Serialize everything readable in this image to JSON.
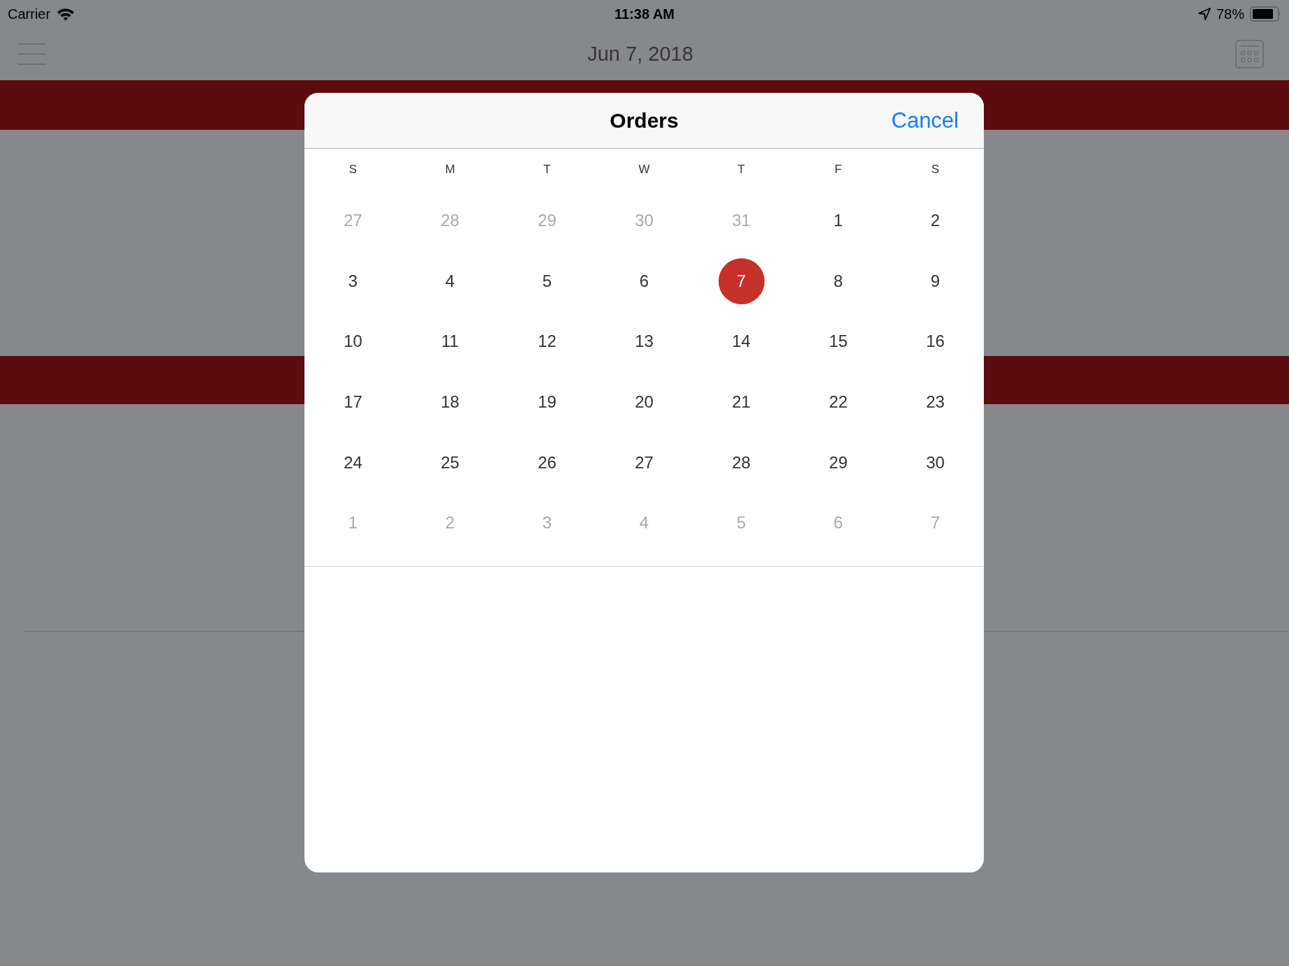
{
  "status_bar": {
    "carrier": "Carrier",
    "time": "11:38 AM",
    "battery": "78%"
  },
  "nav_bar": {
    "title": "Jun 7, 2018"
  },
  "modal": {
    "title": "Orders",
    "cancel": "Cancel",
    "weekdays": [
      "S",
      "M",
      "T",
      "W",
      "T",
      "F",
      "S"
    ],
    "weeks": [
      {
        "days": [
          {
            "day": "27",
            "in_month": false,
            "selected": false
          },
          {
            "day": "28",
            "in_month": false,
            "selected": false
          },
          {
            "day": "29",
            "in_month": false,
            "selected": false
          },
          {
            "day": "30",
            "in_month": false,
            "selected": false
          },
          {
            "day": "31",
            "in_month": false,
            "selected": false
          },
          {
            "day": "1",
            "in_month": true,
            "selected": false
          },
          {
            "day": "2",
            "in_month": true,
            "selected": false
          }
        ]
      },
      {
        "days": [
          {
            "day": "3",
            "in_month": true,
            "selected": false
          },
          {
            "day": "4",
            "in_month": true,
            "selected": false
          },
          {
            "day": "5",
            "in_month": true,
            "selected": false
          },
          {
            "day": "6",
            "in_month": true,
            "selected": false
          },
          {
            "day": "7",
            "in_month": true,
            "selected": true
          },
          {
            "day": "8",
            "in_month": true,
            "selected": false
          },
          {
            "day": "9",
            "in_month": true,
            "selected": false
          }
        ]
      },
      {
        "days": [
          {
            "day": "10",
            "in_month": true,
            "selected": false
          },
          {
            "day": "11",
            "in_month": true,
            "selected": false
          },
          {
            "day": "12",
            "in_month": true,
            "selected": false
          },
          {
            "day": "13",
            "in_month": true,
            "selected": false
          },
          {
            "day": "14",
            "in_month": true,
            "selected": false
          },
          {
            "day": "15",
            "in_month": true,
            "selected": false
          },
          {
            "day": "16",
            "in_month": true,
            "selected": false
          }
        ]
      },
      {
        "days": [
          {
            "day": "17",
            "in_month": true,
            "selected": false
          },
          {
            "day": "18",
            "in_month": true,
            "selected": false
          },
          {
            "day": "19",
            "in_month": true,
            "selected": false
          },
          {
            "day": "20",
            "in_month": true,
            "selected": false
          },
          {
            "day": "21",
            "in_month": true,
            "selected": false
          },
          {
            "day": "22",
            "in_month": true,
            "selected": false
          },
          {
            "day": "23",
            "in_month": true,
            "selected": false
          }
        ]
      },
      {
        "days": [
          {
            "day": "24",
            "in_month": true,
            "selected": false
          },
          {
            "day": "25",
            "in_month": true,
            "selected": false
          },
          {
            "day": "26",
            "in_month": true,
            "selected": false
          },
          {
            "day": "27",
            "in_month": true,
            "selected": false
          },
          {
            "day": "28",
            "in_month": true,
            "selected": false
          },
          {
            "day": "29",
            "in_month": true,
            "selected": false
          },
          {
            "day": "30",
            "in_month": true,
            "selected": false
          }
        ]
      },
      {
        "days": [
          {
            "day": "1",
            "in_month": false,
            "selected": false
          },
          {
            "day": "2",
            "in_month": false,
            "selected": false
          },
          {
            "day": "3",
            "in_month": false,
            "selected": false
          },
          {
            "day": "4",
            "in_month": false,
            "selected": false
          },
          {
            "day": "5",
            "in_month": false,
            "selected": false
          },
          {
            "day": "6",
            "in_month": false,
            "selected": false
          },
          {
            "day": "7",
            "in_month": false,
            "selected": false
          }
        ]
      }
    ]
  }
}
